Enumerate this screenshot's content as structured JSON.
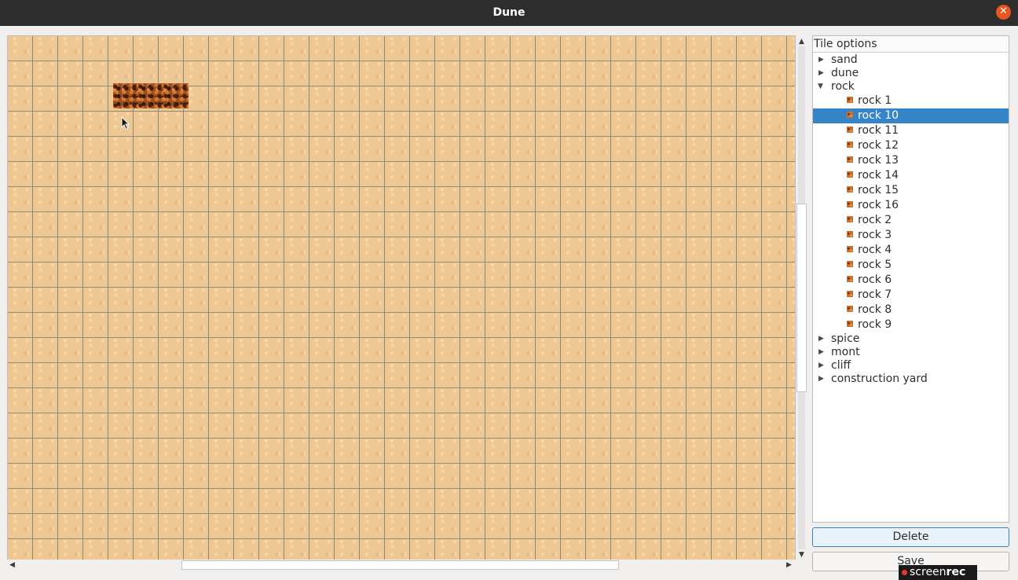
{
  "window": {
    "title": "Dune",
    "close_symbol": "✕"
  },
  "map": {
    "grid": "32px tiles",
    "placed_tiles": [
      "rock",
      "rock",
      "rock"
    ]
  },
  "panel": {
    "header": "Tile options",
    "tree": [
      {
        "label": "sand",
        "expanded": false
      },
      {
        "label": "dune",
        "expanded": false
      },
      {
        "label": "rock",
        "expanded": true,
        "children": [
          "rock 1",
          "rock 10",
          "rock 11",
          "rock 12",
          "rock 13",
          "rock 14",
          "rock 15",
          "rock 16",
          "rock 2",
          "rock 3",
          "rock 4",
          "rock 5",
          "rock 6",
          "rock 7",
          "rock 8",
          "rock 9"
        ],
        "selected_child": "rock 10"
      },
      {
        "label": "spice",
        "expanded": false
      },
      {
        "label": "mont",
        "expanded": false
      },
      {
        "label": "cliff",
        "expanded": false
      },
      {
        "label": "construction yard",
        "expanded": false
      }
    ]
  },
  "buttons": {
    "delete": "Delete",
    "save": "Save"
  },
  "overlay": {
    "brand_light": "screen",
    "brand_bold": "rec"
  },
  "colors": {
    "selection": "#3584c8",
    "titlebar": "#2d2d2d",
    "close": "#e95420",
    "sand": "#efc792",
    "rock": "#a14e1e"
  }
}
